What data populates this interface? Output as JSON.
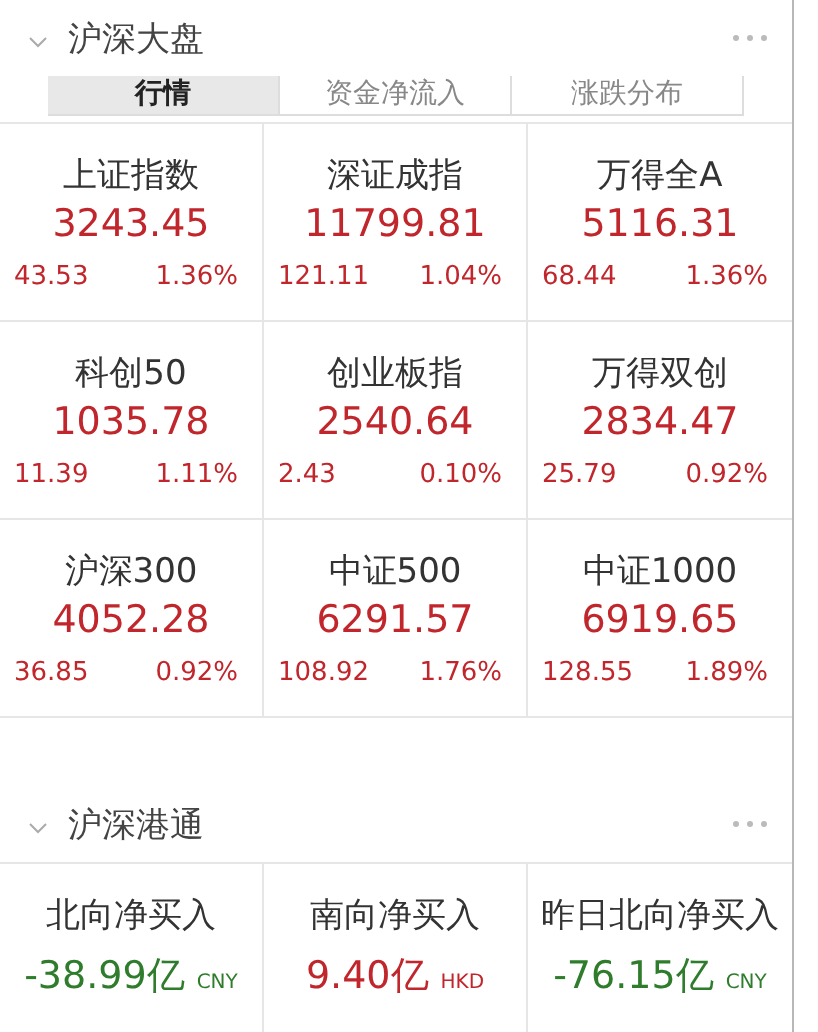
{
  "sections": [
    {
      "title": "沪深大盘",
      "expanded": true,
      "tabs": [
        {
          "label": "行情",
          "selected": true
        },
        {
          "label": "资金净流入",
          "selected": false
        },
        {
          "label": "涨跌分布",
          "selected": false
        }
      ],
      "indices": [
        {
          "name": "上证指数",
          "value": "3243.45",
          "change": "43.53",
          "percent": "1.36%",
          "color": "#c0262b"
        },
        {
          "name": "深证成指",
          "value": "11799.81",
          "change": "121.11",
          "percent": "1.04%",
          "color": "#c0262b"
        },
        {
          "name": "万得全A",
          "value": "5116.31",
          "change": "68.44",
          "percent": "1.36%",
          "color": "#c0262b"
        },
        {
          "name": "科创50",
          "value": "1035.78",
          "change": "11.39",
          "percent": "1.11%",
          "color": "#c0262b"
        },
        {
          "name": "创业板指",
          "value": "2540.64",
          "change": "2.43",
          "percent": "0.10%",
          "color": "#c0262b"
        },
        {
          "name": "万得双创",
          "value": "2834.47",
          "change": "25.79",
          "percent": "0.92%",
          "color": "#c0262b"
        },
        {
          "name": "沪深300",
          "value": "4052.28",
          "change": "36.85",
          "percent": "0.92%",
          "color": "#c0262b"
        },
        {
          "name": "中证500",
          "value": "6291.57",
          "change": "108.92",
          "percent": "1.76%",
          "color": "#c0262b"
        },
        {
          "name": "中证1000",
          "value": "6919.65",
          "change": "128.55",
          "percent": "1.89%",
          "color": "#c0262b"
        }
      ]
    },
    {
      "title": "沪深港通",
      "expanded": true,
      "flows": [
        {
          "name": "北向净买入",
          "value": "-38.99亿",
          "currency": "CNY",
          "color": "#2f7d2c"
        },
        {
          "name": "南向净买入",
          "value": "9.40亿",
          "currency": "HKD",
          "color": "#c0262b"
        },
        {
          "name": "昨日北向净买入",
          "value": "-76.15亿",
          "currency": "CNY",
          "color": "#2f7d2c"
        }
      ]
    }
  ]
}
